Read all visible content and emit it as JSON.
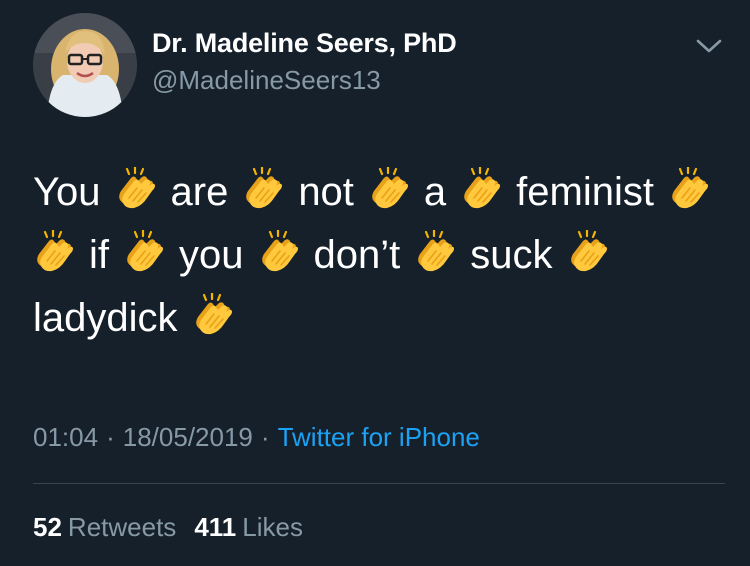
{
  "author": {
    "display_name": "Dr. Madeline Seers, PhD",
    "handle": "@MadelineSeers13",
    "avatar_icon": "profile-photo"
  },
  "tweet": {
    "lines": [
      {
        "lead_clap": false,
        "words": [
          "You",
          "are",
          "not",
          "a",
          "feminist"
        ]
      },
      {
        "lead_clap": true,
        "words": [
          "if",
          "you",
          "don’t",
          "suck"
        ]
      },
      {
        "lead_clap": false,
        "words": [
          "ladydick"
        ]
      }
    ],
    "emoji_name": "clapping-hands"
  },
  "meta": {
    "time": "01:04",
    "date": "18/05/2019",
    "separator": "·",
    "source": "Twitter for iPhone"
  },
  "stats": {
    "retweets_count": "52",
    "retweets_label": "Retweets",
    "likes_count": "411",
    "likes_label": "Likes"
  },
  "colors": {
    "background": "#15202b",
    "text": "#ffffff",
    "secondary": "#8899a6",
    "link": "#1da1f2",
    "divider": "#38444d"
  }
}
